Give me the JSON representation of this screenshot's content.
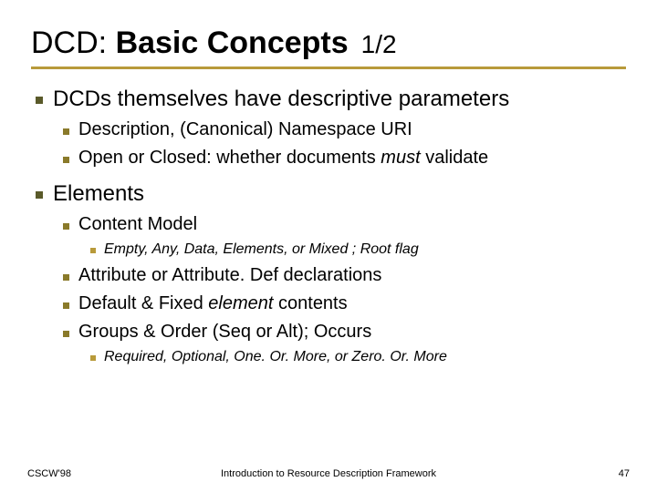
{
  "title": {
    "prefix": "DCD: ",
    "main": "Basic Concepts",
    "page": "1/2"
  },
  "bullets": {
    "b1": "DCDs themselves have descriptive parameters",
    "b1_1": "Description, (Canonical) Namespace URI",
    "b1_2_a": "Open or Closed: whether documents ",
    "b1_2_em": "must",
    "b1_2_b": " validate",
    "b2": "Elements",
    "b2_1": "Content Model",
    "b2_1_1": "Empty, Any, Data, Elements, or Mixed ; Root flag",
    "b2_2": "Attribute or Attribute. Def declarations",
    "b2_3_a": "Default & Fixed ",
    "b2_3_em": "element",
    "b2_3_b": " contents",
    "b2_4": "Groups & Order (Seq or Alt); Occurs",
    "b2_4_1": "Required, Optional, One. Or. More, or Zero. Or. More"
  },
  "footer": {
    "left": "CSCW'98",
    "center": "Introduction to Resource Description Framework",
    "page": "47"
  }
}
